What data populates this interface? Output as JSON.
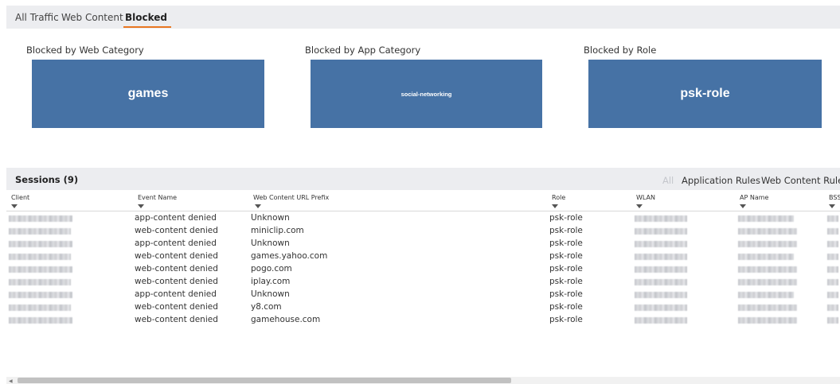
{
  "tabs": [
    "All Traffic",
    "Web Content",
    "Blocked"
  ],
  "active_tab": "Blocked",
  "cards": [
    {
      "title": "Blocked by Web Category",
      "value": "games"
    },
    {
      "title": "Blocked by App Category",
      "value": "social-networking"
    },
    {
      "title": "Blocked by Role",
      "value": "psk-role"
    }
  ],
  "sessions": {
    "title": "Sessions (9)",
    "filters": [
      "All",
      "Application Rules",
      "Web Content Rules"
    ],
    "columns": [
      "Client",
      "Event Name",
      "Web Content URL Prefix",
      "Role",
      "WLAN",
      "AP Name",
      "BSS"
    ],
    "rows": [
      {
        "event": "app-content denied",
        "url": "Unknown",
        "role": "psk-role"
      },
      {
        "event": "web-content denied",
        "url": "miniclip.com",
        "role": "psk-role"
      },
      {
        "event": "app-content denied",
        "url": "Unknown",
        "role": "psk-role"
      },
      {
        "event": "web-content denied",
        "url": "games.yahoo.com",
        "role": "psk-role"
      },
      {
        "event": "web-content denied",
        "url": "pogo.com",
        "role": "psk-role"
      },
      {
        "event": "web-content denied",
        "url": "iplay.com",
        "role": "psk-role"
      },
      {
        "event": "app-content denied",
        "url": "Unknown",
        "role": "psk-role"
      },
      {
        "event": "web-content denied",
        "url": "y8.com",
        "role": "psk-role"
      },
      {
        "event": "web-content denied",
        "url": "gamehouse.com",
        "role": "psk-role"
      }
    ]
  },
  "colors": {
    "card": "#4672a5",
    "accent": "#e87722",
    "header_bg": "#ecedf0"
  }
}
